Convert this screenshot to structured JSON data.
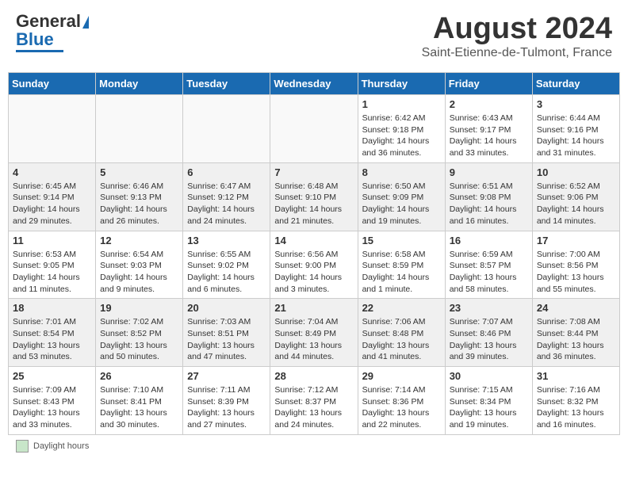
{
  "header": {
    "logo_line1": "General",
    "logo_line2": "Blue",
    "title": "August 2024",
    "subtitle": "Saint-Etienne-de-Tulmont, France"
  },
  "days_of_week": [
    "Sunday",
    "Monday",
    "Tuesday",
    "Wednesday",
    "Thursday",
    "Friday",
    "Saturday"
  ],
  "weeks": [
    [
      {
        "day": "",
        "info": ""
      },
      {
        "day": "",
        "info": ""
      },
      {
        "day": "",
        "info": ""
      },
      {
        "day": "",
        "info": ""
      },
      {
        "day": "1",
        "info": "Sunrise: 6:42 AM\nSunset: 9:18 PM\nDaylight: 14 hours and 36 minutes."
      },
      {
        "day": "2",
        "info": "Sunrise: 6:43 AM\nSunset: 9:17 PM\nDaylight: 14 hours and 33 minutes."
      },
      {
        "day": "3",
        "info": "Sunrise: 6:44 AM\nSunset: 9:16 PM\nDaylight: 14 hours and 31 minutes."
      }
    ],
    [
      {
        "day": "4",
        "info": "Sunrise: 6:45 AM\nSunset: 9:14 PM\nDaylight: 14 hours and 29 minutes."
      },
      {
        "day": "5",
        "info": "Sunrise: 6:46 AM\nSunset: 9:13 PM\nDaylight: 14 hours and 26 minutes."
      },
      {
        "day": "6",
        "info": "Sunrise: 6:47 AM\nSunset: 9:12 PM\nDaylight: 14 hours and 24 minutes."
      },
      {
        "day": "7",
        "info": "Sunrise: 6:48 AM\nSunset: 9:10 PM\nDaylight: 14 hours and 21 minutes."
      },
      {
        "day": "8",
        "info": "Sunrise: 6:50 AM\nSunset: 9:09 PM\nDaylight: 14 hours and 19 minutes."
      },
      {
        "day": "9",
        "info": "Sunrise: 6:51 AM\nSunset: 9:08 PM\nDaylight: 14 hours and 16 minutes."
      },
      {
        "day": "10",
        "info": "Sunrise: 6:52 AM\nSunset: 9:06 PM\nDaylight: 14 hours and 14 minutes."
      }
    ],
    [
      {
        "day": "11",
        "info": "Sunrise: 6:53 AM\nSunset: 9:05 PM\nDaylight: 14 hours and 11 minutes."
      },
      {
        "day": "12",
        "info": "Sunrise: 6:54 AM\nSunset: 9:03 PM\nDaylight: 14 hours and 9 minutes."
      },
      {
        "day": "13",
        "info": "Sunrise: 6:55 AM\nSunset: 9:02 PM\nDaylight: 14 hours and 6 minutes."
      },
      {
        "day": "14",
        "info": "Sunrise: 6:56 AM\nSunset: 9:00 PM\nDaylight: 14 hours and 3 minutes."
      },
      {
        "day": "15",
        "info": "Sunrise: 6:58 AM\nSunset: 8:59 PM\nDaylight: 14 hours and 1 minute."
      },
      {
        "day": "16",
        "info": "Sunrise: 6:59 AM\nSunset: 8:57 PM\nDaylight: 13 hours and 58 minutes."
      },
      {
        "day": "17",
        "info": "Sunrise: 7:00 AM\nSunset: 8:56 PM\nDaylight: 13 hours and 55 minutes."
      }
    ],
    [
      {
        "day": "18",
        "info": "Sunrise: 7:01 AM\nSunset: 8:54 PM\nDaylight: 13 hours and 53 minutes."
      },
      {
        "day": "19",
        "info": "Sunrise: 7:02 AM\nSunset: 8:52 PM\nDaylight: 13 hours and 50 minutes."
      },
      {
        "day": "20",
        "info": "Sunrise: 7:03 AM\nSunset: 8:51 PM\nDaylight: 13 hours and 47 minutes."
      },
      {
        "day": "21",
        "info": "Sunrise: 7:04 AM\nSunset: 8:49 PM\nDaylight: 13 hours and 44 minutes."
      },
      {
        "day": "22",
        "info": "Sunrise: 7:06 AM\nSunset: 8:48 PM\nDaylight: 13 hours and 41 minutes."
      },
      {
        "day": "23",
        "info": "Sunrise: 7:07 AM\nSunset: 8:46 PM\nDaylight: 13 hours and 39 minutes."
      },
      {
        "day": "24",
        "info": "Sunrise: 7:08 AM\nSunset: 8:44 PM\nDaylight: 13 hours and 36 minutes."
      }
    ],
    [
      {
        "day": "25",
        "info": "Sunrise: 7:09 AM\nSunset: 8:43 PM\nDaylight: 13 hours and 33 minutes."
      },
      {
        "day": "26",
        "info": "Sunrise: 7:10 AM\nSunset: 8:41 PM\nDaylight: 13 hours and 30 minutes."
      },
      {
        "day": "27",
        "info": "Sunrise: 7:11 AM\nSunset: 8:39 PM\nDaylight: 13 hours and 27 minutes."
      },
      {
        "day": "28",
        "info": "Sunrise: 7:12 AM\nSunset: 8:37 PM\nDaylight: 13 hours and 24 minutes."
      },
      {
        "day": "29",
        "info": "Sunrise: 7:14 AM\nSunset: 8:36 PM\nDaylight: 13 hours and 22 minutes."
      },
      {
        "day": "30",
        "info": "Sunrise: 7:15 AM\nSunset: 8:34 PM\nDaylight: 13 hours and 19 minutes."
      },
      {
        "day": "31",
        "info": "Sunrise: 7:16 AM\nSunset: 8:32 PM\nDaylight: 13 hours and 16 minutes."
      }
    ]
  ],
  "footer": {
    "legend_label": "Daylight hours"
  }
}
